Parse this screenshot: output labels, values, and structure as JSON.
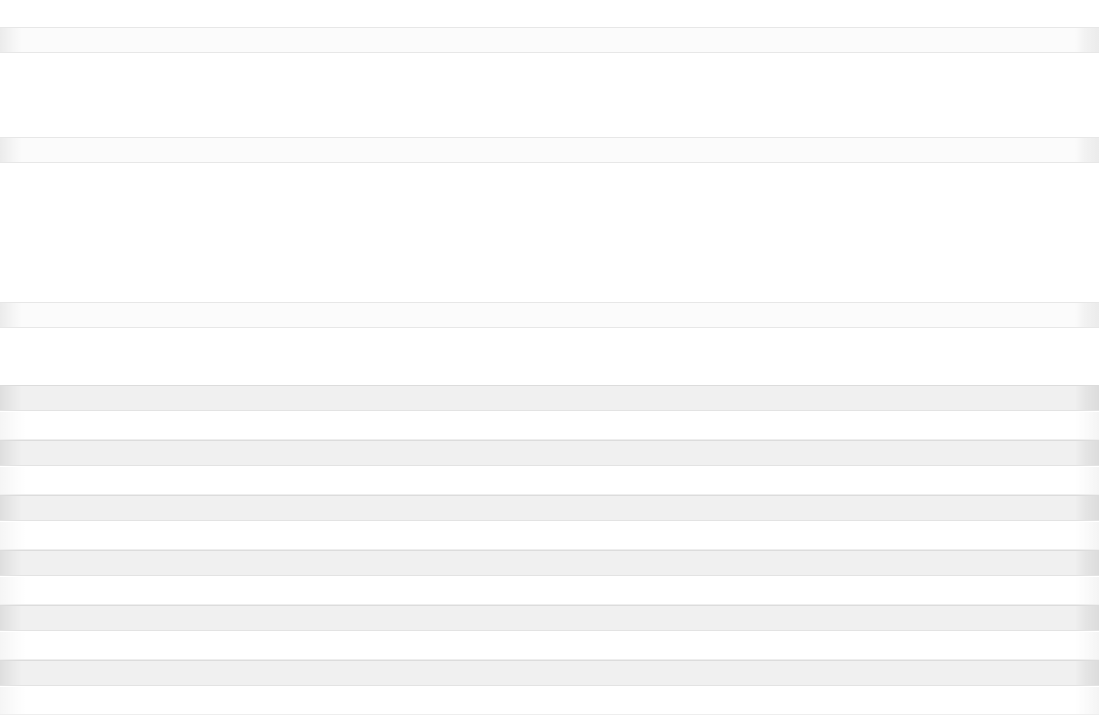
{
  "page": {
    "state": "loading-skeleton",
    "bands": [
      {
        "type": "header-placeholder"
      },
      {
        "type": "header-placeholder"
      },
      {
        "type": "header-placeholder"
      }
    ],
    "rows": [
      {
        "variant": "strong"
      },
      {
        "variant": "light"
      },
      {
        "variant": "strong"
      },
      {
        "variant": "light"
      },
      {
        "variant": "strong"
      },
      {
        "variant": "light"
      },
      {
        "variant": "strong"
      },
      {
        "variant": "light"
      },
      {
        "variant": "strong"
      },
      {
        "variant": "light"
      },
      {
        "variant": "strong"
      },
      {
        "variant": "light"
      }
    ]
  }
}
